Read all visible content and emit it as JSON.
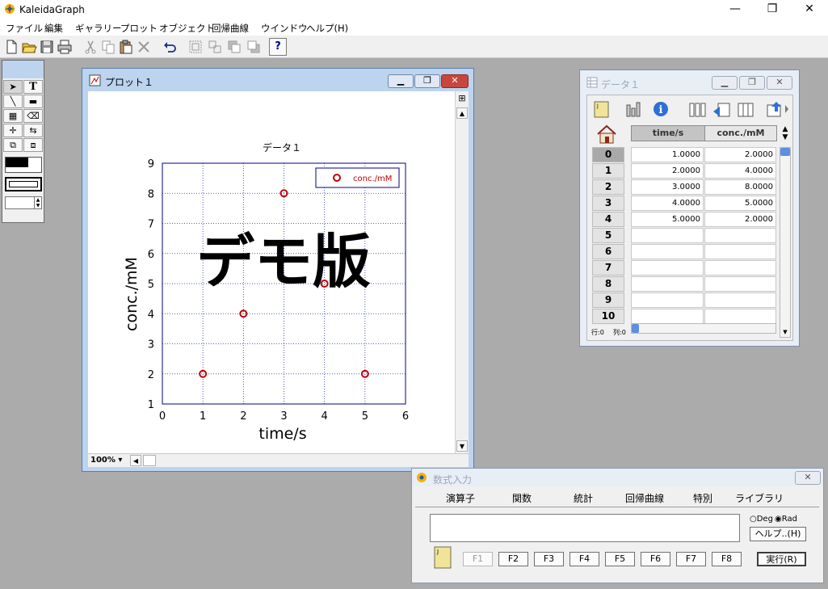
{
  "app": {
    "title": "KaleidaGraph",
    "window_controls": [
      "—",
      "❐",
      "✕"
    ]
  },
  "menu": [
    "ファイル",
    "編集",
    "ギャラリー",
    "プロット",
    "オブジェクト",
    "回帰曲線",
    "ウインドウ",
    "ヘルプ(H)"
  ],
  "toolbar": {
    "help_label": "?",
    "buttons": [
      "new-file",
      "open-folder",
      "save",
      "print",
      "cut",
      "copy",
      "paste",
      "delete",
      "undo",
      "select-group",
      "ungroup",
      "bring-front",
      "send-back",
      "help"
    ]
  },
  "tool_palette": {
    "tools": [
      "pointer",
      "text",
      "line",
      "rectangle",
      "table",
      "eraser",
      "crosshair",
      "data-selector",
      "expand",
      "shrink"
    ]
  },
  "plot_window": {
    "title": "プロット１",
    "zoom": "100%",
    "watermark": "デモ版"
  },
  "chart_data": {
    "type": "scatter",
    "title": "データ１",
    "xlabel": "time/s",
    "ylabel": "conc./mM",
    "xlim": [
      0,
      6
    ],
    "ylim": [
      1,
      9
    ],
    "xticks": [
      "0",
      "1",
      "2",
      "3",
      "4",
      "5",
      "6"
    ],
    "yticks": [
      "1",
      "2",
      "3",
      "4",
      "5",
      "6",
      "7",
      "8",
      "9"
    ],
    "grid": true,
    "legend_position": "top-right",
    "series": [
      {
        "name": "conc./mM",
        "x": [
          1,
          2,
          3,
          4,
          5
        ],
        "y": [
          2,
          4,
          8,
          5,
          2
        ],
        "color": "#c00000"
      }
    ]
  },
  "data_window": {
    "title": "データ１",
    "columns": [
      "time/s",
      "conc./mM"
    ],
    "rows": [
      {
        "index": "0",
        "time": "1.0000",
        "conc": "2.0000"
      },
      {
        "index": "1",
        "time": "2.0000",
        "conc": "4.0000"
      },
      {
        "index": "2",
        "time": "3.0000",
        "conc": "8.0000"
      },
      {
        "index": "3",
        "time": "4.0000",
        "conc": "5.0000"
      },
      {
        "index": "4",
        "time": "5.0000",
        "conc": "2.0000"
      },
      {
        "index": "5",
        "time": "",
        "conc": ""
      },
      {
        "index": "6",
        "time": "",
        "conc": ""
      },
      {
        "index": "7",
        "time": "",
        "conc": ""
      },
      {
        "index": "8",
        "time": "",
        "conc": ""
      },
      {
        "index": "9",
        "time": "",
        "conc": ""
      },
      {
        "index": "10",
        "time": "",
        "conc": ""
      }
    ],
    "status_row": "行:0",
    "status_col": "列:0"
  },
  "formula_window": {
    "title": "数式入力",
    "tabs": [
      "演算子",
      "関数",
      "統計",
      "回帰曲線",
      "特別",
      "ライブラリ"
    ],
    "radio_deg": "Deg",
    "radio_rad": "Rad",
    "help_button": "ヘルプ..(H)",
    "function_keys": [
      "F1",
      "F2",
      "F3",
      "F4",
      "F5",
      "F6",
      "F7",
      "F8"
    ],
    "run_button": "実行(R)",
    "input_value": ""
  },
  "colors": {
    "plot_frame": "#00008b",
    "marker": "#c00000",
    "window_caption": "#bcd4ee"
  }
}
